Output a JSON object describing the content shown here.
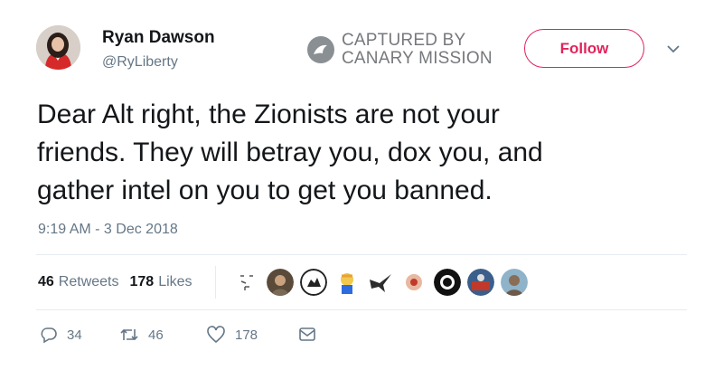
{
  "author": {
    "name": "Ryan Dawson",
    "handle": "@RyLiberty",
    "avatar_icon": "profile-photo"
  },
  "watermark": {
    "line1": "CAPTURED BY",
    "line2": "CANARY MISSION"
  },
  "follow_label": "Follow",
  "tweet_text": "Dear Alt right, the Zionists are not your\nfriends. They will betray you, dox you, and\ngather intel on you to get you banned.",
  "timestamp": "9:19 AM - 3 Dec 2018",
  "stats": {
    "retweets_count": "46",
    "retweets_label": "Retweets",
    "likes_count": "178",
    "likes_label": "Likes"
  },
  "actions": {
    "replies": "34",
    "retweets": "46",
    "likes": "178"
  },
  "colors": {
    "follow_accent": "#e0245e",
    "secondary_text": "#657786",
    "primary_text": "#14171a",
    "divider": "#e6ecf0"
  }
}
